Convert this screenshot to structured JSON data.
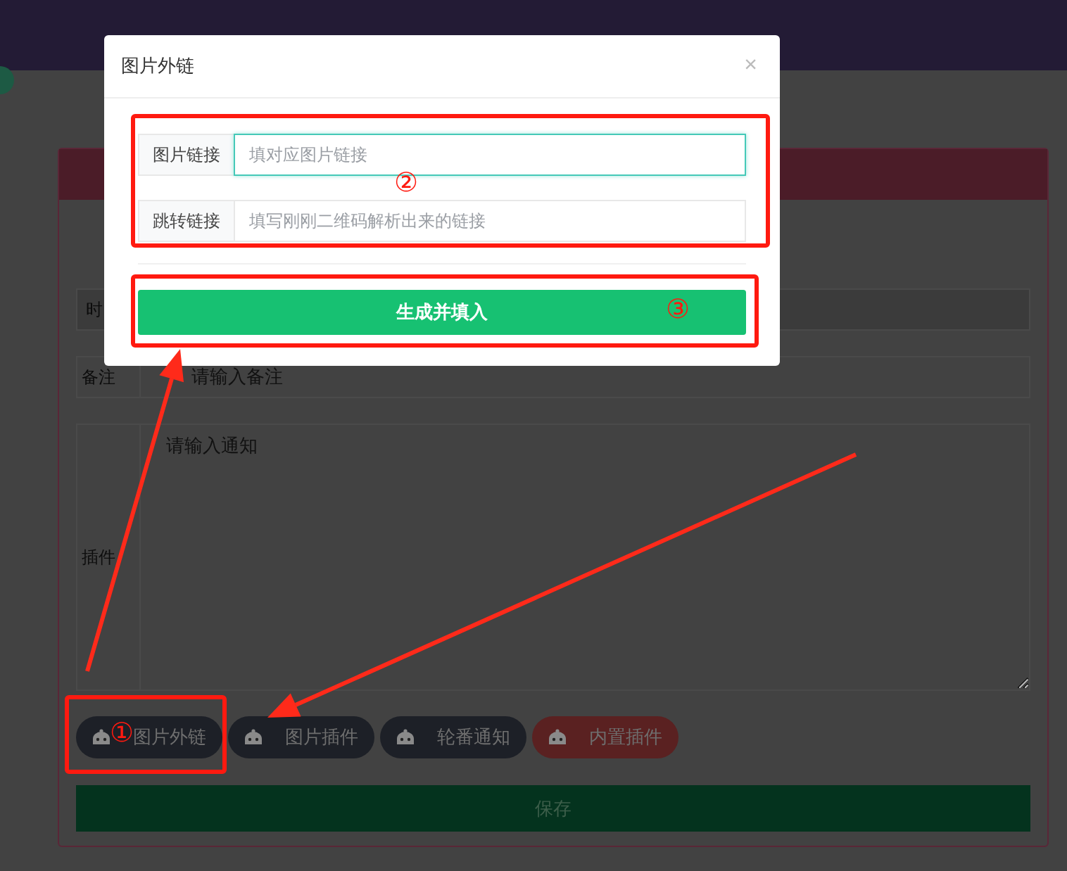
{
  "form": {
    "rows": [
      {
        "kind": "input",
        "label": "时"
      },
      {
        "kind": "input",
        "label": "备注",
        "placeholder": "请输入备注"
      },
      {
        "kind": "textarea",
        "label": "插件",
        "placeholder": "请输入通知"
      }
    ]
  },
  "plugin_buttons": [
    {
      "label": "图片外链",
      "color": "#1d2027"
    },
    {
      "label": "图片插件",
      "color": "#1d2027"
    },
    {
      "label": "轮番通知",
      "color": "#1d2027"
    },
    {
      "label": "内置插件",
      "color": "#5a2121"
    }
  ],
  "save_button": "保存",
  "dialog": {
    "title": "图片外链",
    "close": "×",
    "fields": [
      {
        "label": "图片链接",
        "placeholder": "填对应图片链接",
        "focused": true
      },
      {
        "label": "跳转链接",
        "placeholder": "填写刚刚二维码解析出来的链接",
        "focused": false
      }
    ],
    "submit": "生成并填入"
  },
  "annotations": {
    "markers": [
      "①",
      "②",
      "③"
    ]
  }
}
